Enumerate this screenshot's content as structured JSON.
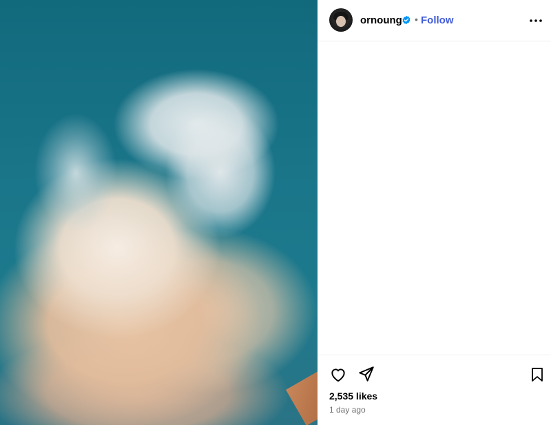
{
  "post": {
    "username": "ornoung",
    "separator": "•",
    "follow_label": "Follow",
    "likes": "2,535 likes",
    "time": "1 day ago"
  },
  "icons": {
    "verified": "verified-badge-icon",
    "more": "more-options-icon",
    "like": "heart-icon",
    "share": "share-icon",
    "save": "bookmark-icon"
  },
  "colors": {
    "follow": "#3f5bd8",
    "verified": "#0095f6",
    "sky": "#1a7589"
  }
}
